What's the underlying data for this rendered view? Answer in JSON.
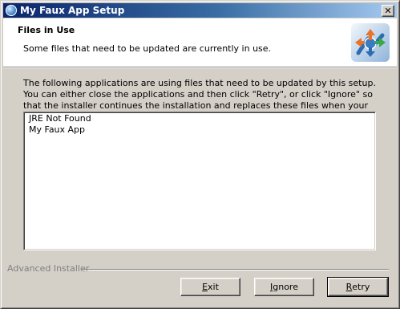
{
  "window": {
    "title": "My Faux App Setup",
    "close_glyph": "✕"
  },
  "header": {
    "title": "Files in Use",
    "subtitle": "Some files that need to be updated are currently in use.",
    "logo_icon": "installer-logo-icon"
  },
  "body": {
    "description": "The following applications are using files that need to be updated by this setup. You can either close the applications and then click \"Retry\", or click \"Ignore\" so that the installer continues the installation and replaces these files when your system restarts.",
    "list_items": [
      "JRE Not Found",
      "My Faux App"
    ]
  },
  "footer": {
    "brand": "Advanced Installer",
    "buttons": {
      "exit": {
        "mnemonic": "E",
        "rest": "xit"
      },
      "ignore": {
        "mnemonic": "I",
        "rest": "gnore"
      },
      "retry": {
        "mnemonic": "R",
        "rest": "etry"
      }
    }
  },
  "colors": {
    "title_gradient_start": "#0a246a",
    "title_gradient_end": "#a6caf0",
    "dialog_face": "#d4d0c8"
  }
}
